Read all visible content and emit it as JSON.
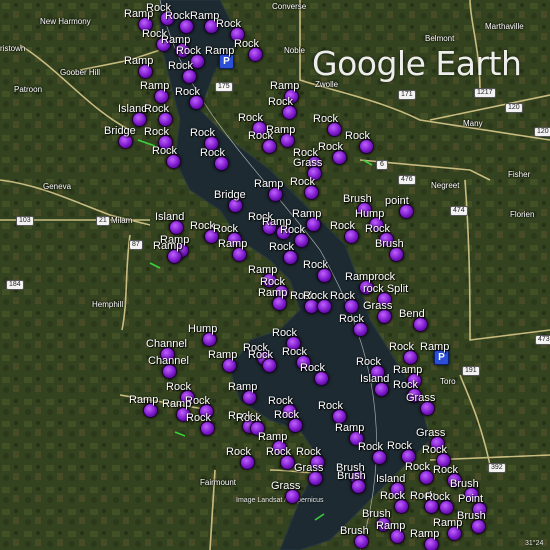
{
  "map": {
    "watermark": "Google Earth",
    "credit": "Image Landsat / Copernicus",
    "coordinate_fragment": "31°24",
    "towns": [
      {
        "id": "new-harmony",
        "text": "New Harmony"
      },
      {
        "id": "converse",
        "text": "Converse"
      },
      {
        "id": "marthaville",
        "text": "Marthaville"
      },
      {
        "id": "belmont",
        "text": "Belmont"
      },
      {
        "id": "noble",
        "text": "Noble"
      },
      {
        "id": "zwolle",
        "text": "Zwolle"
      },
      {
        "id": "patroon",
        "text": "Patroon"
      },
      {
        "id": "goober-hill",
        "text": "Goober Hill"
      },
      {
        "id": "geneva",
        "text": "Geneva"
      },
      {
        "id": "milam",
        "text": "Milam"
      },
      {
        "id": "hemphill",
        "text": "Hemphill"
      },
      {
        "id": "many",
        "text": "Many"
      },
      {
        "id": "fisher",
        "text": "Fisher"
      },
      {
        "id": "florien",
        "text": "Florien"
      },
      {
        "id": "negreet",
        "text": "Negreet"
      },
      {
        "id": "toro",
        "text": "Toro"
      },
      {
        "id": "fairmount",
        "text": "Fairmount"
      },
      {
        "id": "ristown",
        "text": "ristown"
      }
    ],
    "highways": [
      "103",
      "87",
      "21",
      "184",
      "175",
      "171",
      "191",
      "6",
      "476",
      "474",
      "392",
      "473",
      "120",
      "1217",
      "120"
    ],
    "poi_markers": [
      {
        "label": "Ramp",
        "icon": "purple-globe"
      },
      {
        "label": "Rock",
        "icon": "purple-globe"
      },
      {
        "label": "Rock",
        "icon": "purple-globe"
      },
      {
        "label": "Ramp",
        "icon": "purple-globe"
      },
      {
        "label": "Rock",
        "icon": "purple-globe"
      },
      {
        "label": "Rock",
        "icon": "purple-globe"
      },
      {
        "label": "Ramp",
        "icon": "purple-globe"
      },
      {
        "label": "Rock",
        "icon": "purple-globe"
      },
      {
        "label": "Ramp",
        "icon": "parking"
      },
      {
        "label": "Rock",
        "icon": "purple-globe"
      },
      {
        "label": "Ramp",
        "icon": "purple-globe"
      },
      {
        "label": "Rock",
        "icon": "purple-globe"
      },
      {
        "label": "Island",
        "icon": "purple-globe"
      },
      {
        "label": "Rock",
        "icon": "purple-globe"
      },
      {
        "label": "Ramp",
        "icon": "purple-globe"
      },
      {
        "label": "Rock",
        "icon": "purple-globe"
      },
      {
        "label": "Ramp",
        "icon": "purple-globe"
      },
      {
        "label": "Rock",
        "icon": "purple-globe"
      },
      {
        "label": "Bridge",
        "icon": "purple-globe"
      },
      {
        "label": "Rock",
        "icon": "purple-globe"
      },
      {
        "label": "Rock",
        "icon": "purple-globe"
      },
      {
        "label": "Rock",
        "icon": "purple-globe"
      },
      {
        "label": "Rock",
        "icon": "purple-globe"
      },
      {
        "label": "Ramp",
        "icon": "purple-globe"
      },
      {
        "label": "Rock",
        "icon": "purple-globe"
      },
      {
        "label": "Rock",
        "icon": "purple-globe"
      },
      {
        "label": "Rock",
        "icon": "purple-globe"
      },
      {
        "label": "Rock",
        "icon": "purple-globe"
      },
      {
        "label": "Rock",
        "icon": "purple-globe"
      },
      {
        "label": "Grass",
        "icon": "purple-globe"
      },
      {
        "label": "Rock",
        "icon": "purple-globe"
      },
      {
        "label": "Ramp",
        "icon": "purple-globe"
      },
      {
        "label": "Rock",
        "icon": "purple-globe"
      },
      {
        "label": "Ramp",
        "icon": "purple-globe"
      },
      {
        "label": "Brush",
        "icon": "purple-globe"
      },
      {
        "label": "point",
        "icon": "purple-globe"
      },
      {
        "label": "Bridge",
        "icon": "purple-globe"
      },
      {
        "label": "Rock",
        "icon": "purple-globe"
      },
      {
        "label": "Hump",
        "icon": "purple-globe"
      },
      {
        "label": "Island",
        "icon": "purple-globe"
      },
      {
        "label": "Rock",
        "icon": "purple-globe"
      },
      {
        "label": "Rock",
        "icon": "purple-globe"
      },
      {
        "label": "Ramp",
        "icon": "purple-globe"
      },
      {
        "label": "Ramp",
        "icon": "purple-globe"
      },
      {
        "label": "Rock",
        "icon": "purple-globe"
      },
      {
        "label": "Rock",
        "icon": "purple-globe"
      },
      {
        "label": "Rock",
        "icon": "purple-globe"
      },
      {
        "label": "Ramp",
        "icon": "purple-globe"
      },
      {
        "label": "Rock",
        "icon": "purple-globe"
      },
      {
        "label": "Ramp",
        "icon": "purple-globe"
      },
      {
        "label": "Ramp",
        "icon": "purple-globe"
      },
      {
        "label": "Rock",
        "icon": "purple-globe"
      },
      {
        "label": "Brush",
        "icon": "purple-globe"
      },
      {
        "label": "Rock",
        "icon": "purple-globe"
      },
      {
        "label": "Rock",
        "icon": "purple-globe"
      },
      {
        "label": "Ramprock",
        "icon": "purple-globe"
      },
      {
        "label": "Ramp",
        "icon": "purple-globe"
      },
      {
        "label": "Rock",
        "icon": "purple-globe"
      },
      {
        "label": "Rock",
        "icon": "purple-globe"
      },
      {
        "label": "rock Split",
        "icon": "purple-globe"
      },
      {
        "label": "Grass",
        "icon": "purple-globe"
      },
      {
        "label": "Rock",
        "icon": "purple-globe"
      },
      {
        "label": "Bend",
        "icon": "purple-globe"
      },
      {
        "label": "Hump",
        "icon": "purple-globe"
      },
      {
        "label": "Rock",
        "icon": "purple-globe"
      },
      {
        "label": "Channel",
        "icon": "purple-globe"
      },
      {
        "label": "Rock",
        "icon": "purple-globe"
      },
      {
        "label": "Rock",
        "icon": "purple-globe"
      },
      {
        "label": "Ramp",
        "icon": "parking"
      },
      {
        "label": "Channel",
        "icon": "purple-globe"
      },
      {
        "label": "Ramp",
        "icon": "purple-globe"
      },
      {
        "label": "Rock",
        "icon": "purple-globe"
      },
      {
        "label": "Rock",
        "icon": "purple-globe"
      },
      {
        "label": "Rock",
        "icon": "purple-globe"
      },
      {
        "label": "Rock",
        "icon": "purple-globe"
      },
      {
        "label": "Island",
        "icon": "purple-globe"
      },
      {
        "label": "Ramp",
        "icon": "purple-globe"
      },
      {
        "label": "Rock",
        "icon": "purple-globe"
      },
      {
        "label": "Rock",
        "icon": "purple-globe"
      },
      {
        "label": "Ramp",
        "icon": "purple-globe"
      },
      {
        "label": "Ramp",
        "icon": "purple-globe"
      },
      {
        "label": "Rock",
        "icon": "purple-globe"
      },
      {
        "label": "Ramp",
        "icon": "purple-globe"
      },
      {
        "label": "Rock",
        "icon": "purple-globe"
      },
      {
        "label": "Rock",
        "icon": "purple-globe"
      },
      {
        "label": "Grass",
        "icon": "purple-globe"
      },
      {
        "label": "Rock",
        "icon": "purple-globe"
      },
      {
        "label": "Rock",
        "icon": "purple-globe"
      },
      {
        "label": "Ramp",
        "icon": "purple-globe"
      },
      {
        "label": "Rock",
        "icon": "purple-globe"
      },
      {
        "label": "Rock",
        "icon": "purple-globe"
      },
      {
        "label": "Grass",
        "icon": "purple-globe"
      },
      {
        "label": "Ramp",
        "icon": "purple-globe"
      },
      {
        "label": "Rock",
        "icon": "purple-globe"
      },
      {
        "label": "Rock",
        "icon": "purple-globe"
      },
      {
        "label": "Rock",
        "icon": "purple-globe"
      },
      {
        "label": "Rock",
        "icon": "purple-globe"
      },
      {
        "label": "Rock",
        "icon": "purple-globe"
      },
      {
        "label": "Rock",
        "icon": "purple-globe"
      },
      {
        "label": "Grass",
        "icon": "purple-globe"
      },
      {
        "label": "Brush",
        "icon": "purple-globe"
      },
      {
        "label": "Rock",
        "icon": "purple-globe"
      },
      {
        "label": "Grass",
        "icon": "purple-globe"
      },
      {
        "label": "Brush",
        "icon": "purple-globe"
      },
      {
        "label": "Island",
        "icon": "purple-globe"
      },
      {
        "label": "Rock",
        "icon": "purple-globe"
      },
      {
        "label": "Brush",
        "icon": "purple-globe"
      },
      {
        "label": "Rock",
        "icon": "purple-globe"
      },
      {
        "label": "Rock",
        "icon": "purple-globe"
      },
      {
        "label": "Rock",
        "icon": "purple-globe"
      },
      {
        "label": "Point",
        "icon": "purple-globe"
      },
      {
        "label": "Brush",
        "icon": "purple-globe"
      },
      {
        "label": "Ramp",
        "icon": "purple-globe"
      },
      {
        "label": "Brush",
        "icon": "purple-globe"
      },
      {
        "label": "Brush",
        "icon": "purple-globe"
      },
      {
        "label": "Ramp",
        "icon": "purple-globe"
      },
      {
        "label": "Ramp",
        "icon": "purple-globe"
      }
    ]
  }
}
